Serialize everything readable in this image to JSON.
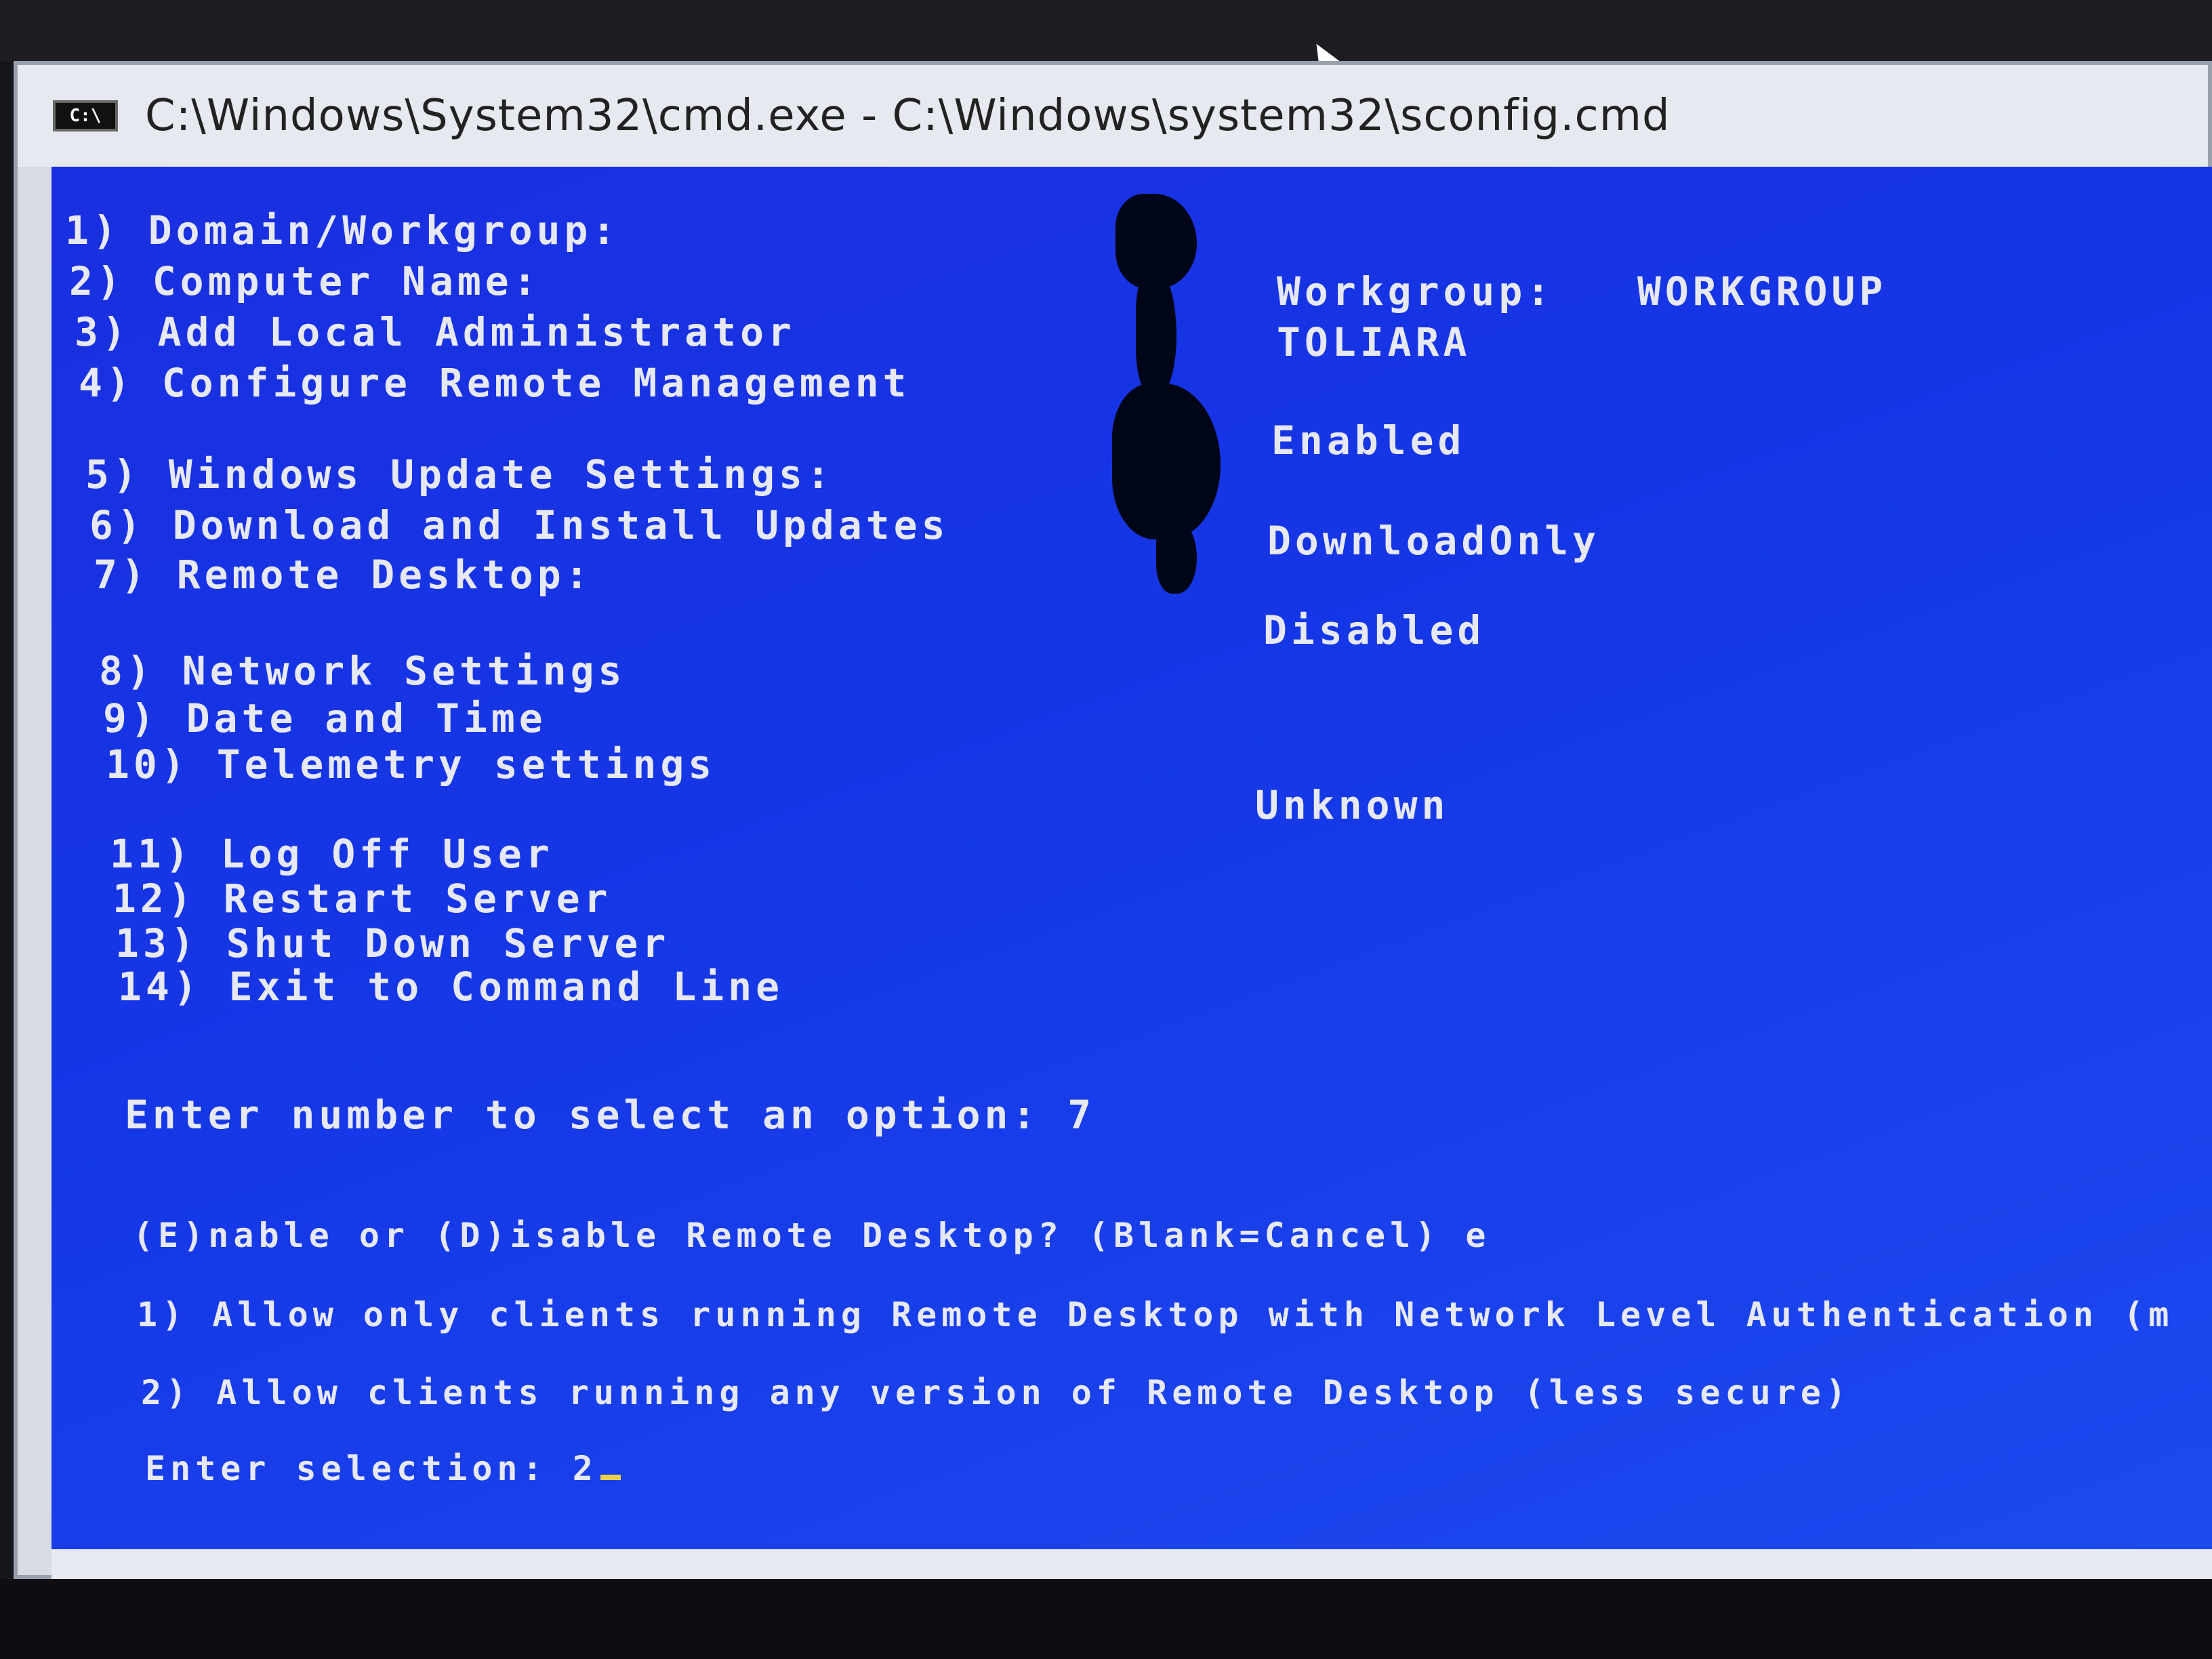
{
  "window": {
    "icon_label": "C:\\",
    "title": "C:\\Windows\\System32\\cmd.exe - C:\\Windows\\system32\\sconfig.cmd"
  },
  "menu": [
    {
      "num": "1)",
      "label": "Domain/Workgroup:",
      "value": "Workgroup:   WORKGROUP"
    },
    {
      "num": "2)",
      "label": "Computer Name:",
      "value": "TOLIARA"
    },
    {
      "num": "3)",
      "label": "Add Local Administrator",
      "value": ""
    },
    {
      "num": "4)",
      "label": "Configure Remote Management",
      "value": "Enabled"
    },
    {
      "num": "5)",
      "label": "Windows Update Settings:",
      "value": "DownloadOnly"
    },
    {
      "num": "6)",
      "label": "Download and Install Updates",
      "value": ""
    },
    {
      "num": "7)",
      "label": "Remote Desktop:",
      "value": "Disabled"
    },
    {
      "num": "8)",
      "label": "Network Settings",
      "value": ""
    },
    {
      "num": "9)",
      "label": "Date and Time",
      "value": ""
    },
    {
      "num": "10)",
      "label": "Telemetry settings",
      "value": "Unknown"
    },
    {
      "num": "11)",
      "label": "Log Off User",
      "value": ""
    },
    {
      "num": "12)",
      "label": "Restart Server",
      "value": ""
    },
    {
      "num": "13)",
      "label": "Shut Down Server",
      "value": ""
    },
    {
      "num": "14)",
      "label": "Exit to Command Line",
      "value": ""
    }
  ],
  "prompts": {
    "select_option": "Enter number to select an option: 7",
    "enable_disable": "(E)nable or (D)isable Remote Desktop? (Blank=Cancel) e",
    "nla_option": "1) Allow only clients running Remote Desktop with Network Level Authentication (m",
    "any_version_option": "2) Allow clients running any version of Remote Desktop (less secure)",
    "enter_selection": "Enter selection: 2"
  },
  "colors": {
    "console_bg": "#1537e6",
    "console_text": "#e6e8f4",
    "cursor": "#e8d14a"
  }
}
